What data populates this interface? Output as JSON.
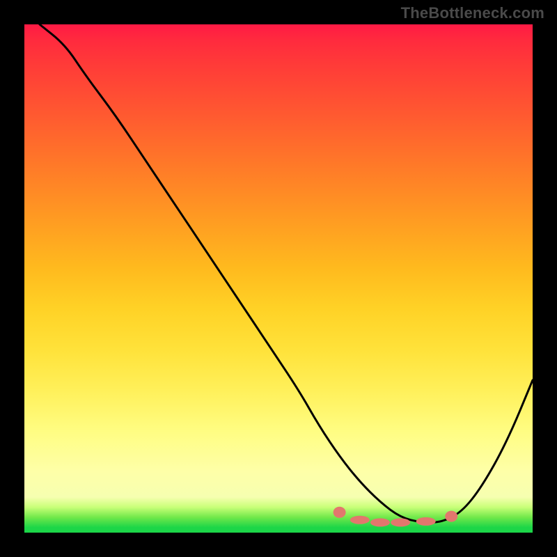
{
  "watermark": "TheBottleneck.com",
  "chart_data": {
    "type": "line",
    "title": "",
    "xlabel": "",
    "ylabel": "",
    "xlim": [
      0,
      100
    ],
    "ylim": [
      0,
      100
    ],
    "grid": false,
    "legend": false,
    "background": "rainbow-gradient-red-to-green-vertical",
    "series": [
      {
        "name": "bottleneck-curve",
        "stroke": "#000000",
        "x": [
          3,
          8,
          12,
          18,
          24,
          30,
          36,
          42,
          48,
          54,
          58,
          62,
          66,
          70,
          74,
          78,
          82,
          86,
          90,
          95,
          100
        ],
        "values": [
          100,
          96,
          90,
          82,
          73,
          64,
          55,
          46,
          37,
          28,
          21,
          15,
          10,
          6,
          3,
          2,
          2,
          4,
          9,
          18,
          30
        ]
      }
    ],
    "markers": [
      {
        "name": "trough-markers",
        "color": "#e2776d",
        "shape": "rounded-lozenge",
        "x": [
          62,
          66,
          70,
          74,
          79,
          84
        ],
        "values": [
          4,
          2.5,
          2,
          2,
          2.2,
          3.2
        ]
      }
    ],
    "annotations": []
  }
}
